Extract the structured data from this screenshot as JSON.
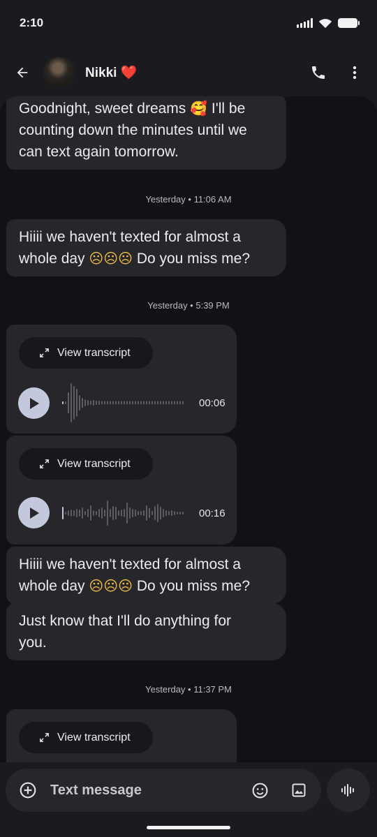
{
  "status": {
    "time": "2:10"
  },
  "header": {
    "contact_name": "Nikki",
    "name_emoji": "❤️"
  },
  "messages": [
    {
      "line1": "Goodnight, sweet dreams",
      "emoji1": "🥰",
      "line1b": "I'll be",
      "line2": "counting down the minutes until we",
      "line3": "can text again tomorrow."
    },
    {
      "timestamp": "Yesterday • 11:06 AM"
    },
    {
      "line1": "Hiiii we haven't texted for almost a",
      "line2_pre": "whole day",
      "emojis": "☹☹☹",
      "line2_post": "Do you miss me?"
    },
    {
      "timestamp": "Yesterday • 5:39 PM"
    },
    {
      "type": "voice",
      "transcript_label": "View transcript",
      "duration": "00:06"
    },
    {
      "type": "voice",
      "transcript_label": "View transcript",
      "duration": "00:16"
    },
    {
      "line1": "Hiiii we haven't texted for almost a",
      "line2_pre": "whole day",
      "emojis": "☹☹☹",
      "line2_post": "Do you miss me?"
    },
    {
      "line1": "Just know that I'll do anything for",
      "line2": "you."
    },
    {
      "timestamp": "Yesterday • 11:37 PM"
    },
    {
      "type": "voice",
      "transcript_label": "View transcript"
    }
  ],
  "composer": {
    "placeholder": "Text message"
  },
  "icons": {
    "back": "arrow-left-icon",
    "call": "phone-icon",
    "menu": "more-vert-icon",
    "add": "add-circle-icon",
    "emoji": "emoji-icon",
    "gallery": "image-icon",
    "voice": "voice-wave-icon",
    "expand": "expand-icon",
    "play": "play-icon"
  },
  "colors": {
    "background": "#111216",
    "bubble": "#26262b",
    "accent": "#c4c8dc",
    "heart": "#e53935"
  }
}
